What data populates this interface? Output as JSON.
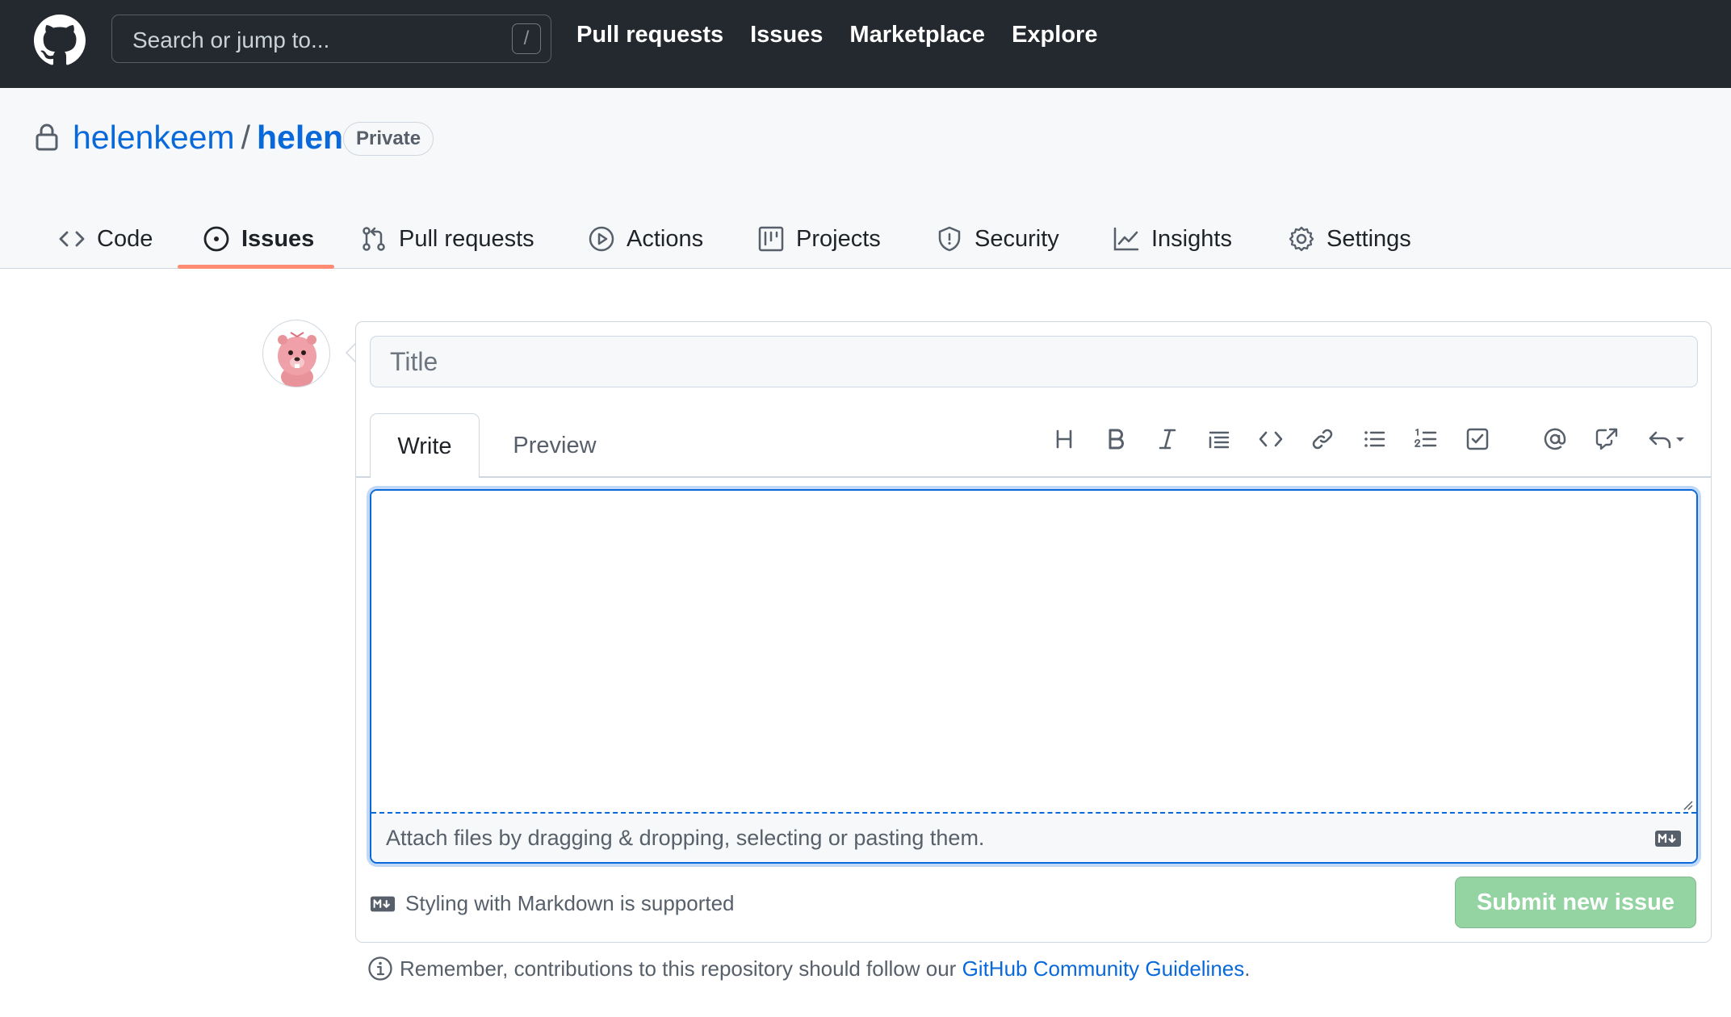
{
  "header": {
    "logo_icon": "github-mark-icon",
    "search_placeholder": "Search or jump to...",
    "search_shortcut": "/",
    "nav": [
      "Pull requests",
      "Issues",
      "Marketplace",
      "Explore"
    ]
  },
  "repo": {
    "owner": "helenkeem",
    "separator": "/",
    "name": "helen",
    "visibility": "Private",
    "tabs": [
      {
        "label": "Code",
        "icon": "code-icon"
      },
      {
        "label": "Issues",
        "icon": "issue-opened-icon",
        "selected": true
      },
      {
        "label": "Pull requests",
        "icon": "git-pull-request-icon"
      },
      {
        "label": "Actions",
        "icon": "play-icon"
      },
      {
        "label": "Projects",
        "icon": "project-icon"
      },
      {
        "label": "Security",
        "icon": "shield-icon"
      },
      {
        "label": "Insights",
        "icon": "graph-icon"
      },
      {
        "label": "Settings",
        "icon": "gear-icon"
      }
    ]
  },
  "composer": {
    "title_placeholder": "Title",
    "write_tab": "Write",
    "preview_tab": "Preview",
    "toolbar": [
      "heading-icon",
      "bold-icon",
      "italic-icon",
      "quote-icon",
      "code-icon",
      "link-icon",
      "unordered-list-icon",
      "ordered-list-icon",
      "tasklist-icon",
      "mention-icon",
      "cross-reference-icon",
      "saved-replies-icon"
    ],
    "body_value": "",
    "attach_text": "Attach files by dragging & dropping, selecting or pasting them.",
    "markdown_note": "Styling with Markdown is supported",
    "submit_label": "Submit new issue"
  },
  "footer": {
    "guidelines_prefix": "Remember, contributions to this repository should follow our ",
    "guidelines_link": "GitHub Community Guidelines",
    "guidelines_suffix": "."
  },
  "colors": {
    "header_bg": "#24292f",
    "link": "#0969da",
    "tab_underline": "#fd8c73",
    "submit_disabled": "#94d3a2",
    "focus": "#0969da"
  }
}
